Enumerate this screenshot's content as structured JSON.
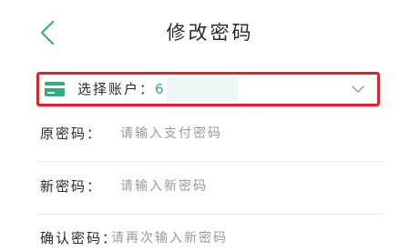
{
  "header": {
    "title": "修改密码",
    "back_icon": "chevron-left-icon"
  },
  "account_select": {
    "label": "选择账户：",
    "value": "6",
    "card_icon": "bank-card-icon",
    "expand_icon": "chevron-down-icon",
    "icon_color": "#2fb07a",
    "highlight_color": "#e0232b"
  },
  "fields": [
    {
      "label": "原密码：",
      "placeholder": "请输入支付密码",
      "value": ""
    },
    {
      "label": "新密码：",
      "placeholder": "请输入新密码",
      "value": ""
    },
    {
      "label": "确认密码：",
      "placeholder": "请再次输入新密码",
      "value": ""
    }
  ],
  "colors": {
    "accent": "#3aa89a",
    "text": "#2a2a2a",
    "placeholder": "#9a9a9a"
  }
}
